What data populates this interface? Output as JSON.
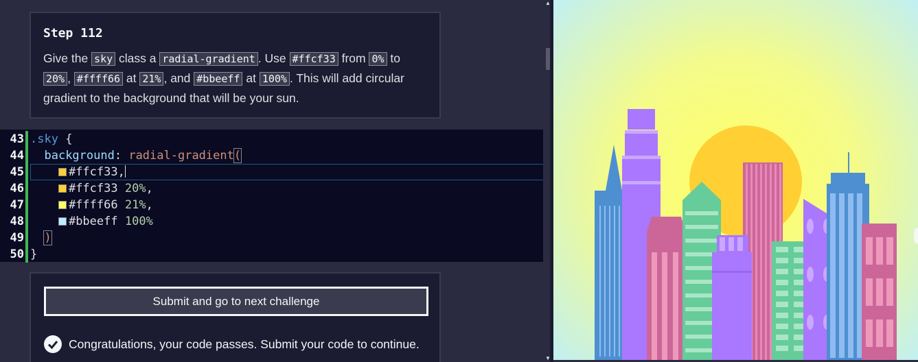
{
  "instructions": {
    "title": "Step 112",
    "desc": {
      "t1": "Give the ",
      "c1": "sky",
      "t2": " class a ",
      "c2": "radial-gradient",
      "t3": ". Use ",
      "c3": "#ffcf33",
      "t4": " from ",
      "c4": "0%",
      "t5": " to ",
      "c5": "20%",
      "t6": ", ",
      "c6": "#ffff66",
      "t7": " at ",
      "c7": "21%",
      "t8": ", and ",
      "c8": "#bbeeff",
      "t9": " at ",
      "c9": "100%",
      "t10": ". This will add circular gradient to the background that will be your sun."
    }
  },
  "editor": {
    "lines": [
      {
        "num": "43",
        "selector": ".sky",
        "brace": " {"
      },
      {
        "num": "44",
        "prop": "background",
        "colon": ": ",
        "fn": "radial-gradient",
        "paren": "("
      },
      {
        "num": "45",
        "color": "#ffcf33",
        "rest": ","
      },
      {
        "num": "46",
        "color": "#ffcf33",
        "pct": "20%",
        "rest": ","
      },
      {
        "num": "47",
        "color": "#ffff66",
        "pct": "21%",
        "rest": ","
      },
      {
        "num": "48",
        "color": "#bbeeff",
        "pct": "100%"
      },
      {
        "num": "49",
        "paren": ")"
      },
      {
        "num": "50",
        "brace": "}"
      }
    ],
    "swatch_colors": [
      "#ffcf33",
      "#ffcf33",
      "#ffff66",
      "#bbeeff"
    ]
  },
  "submit": {
    "button_label": "Submit and go to next challenge",
    "success_message": "Congratulations, your code passes. Submit your code to continue."
  },
  "scrollbar": {
    "up_icon": "▲",
    "down_icon": "▼"
  },
  "colors": {
    "sun": "#ffcf33",
    "sky_mid": "#ffff66",
    "sky_outer": "#bbeeff",
    "building_blue": "#4d8fd1",
    "building_purple": "#aa77ff",
    "building_pink": "#cc6699",
    "building_green": "#66cc99"
  }
}
